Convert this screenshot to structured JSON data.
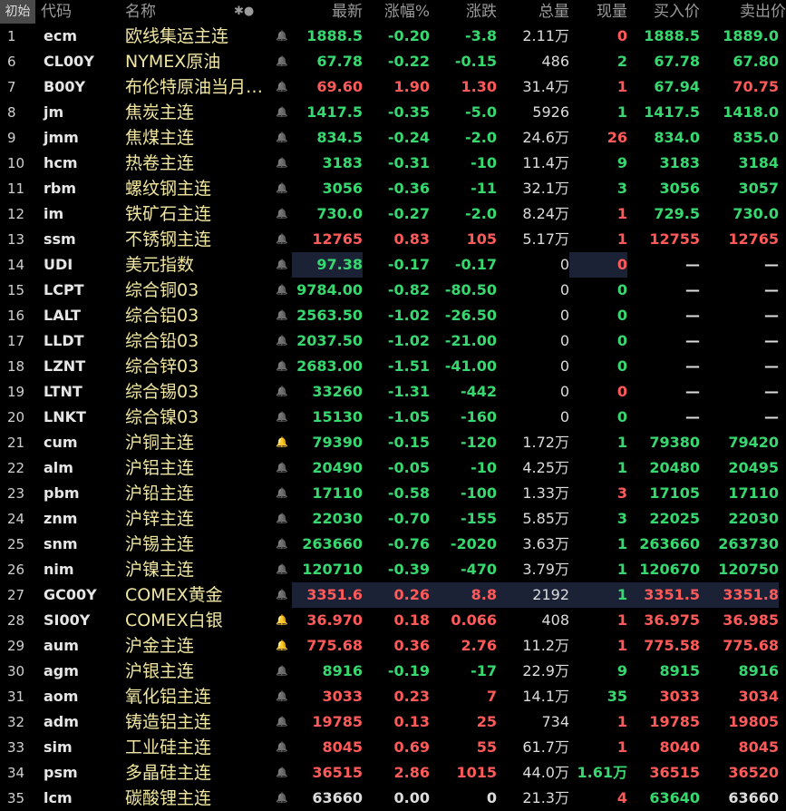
{
  "header": {
    "first": "初始",
    "code": "代码",
    "name": "名称",
    "icons": "✱●",
    "last": "最新",
    "pct": "涨幅%",
    "chg": "涨跌",
    "vol": "总量",
    "cur": "现量",
    "bid": "买入价",
    "ask": "卖出价"
  },
  "rows": [
    {
      "idx": "1",
      "code": "ecm",
      "name": "欧线集运主连",
      "bell": "off",
      "last": "1888.5",
      "pct": "-0.20",
      "chg": "-3.8",
      "vol": "2.11万",
      "cur": "0",
      "bid": "1888.5",
      "ask": "1889.0",
      "dir": "dn",
      "curdir": "up",
      "biddir": "dn",
      "askdir": "dn"
    },
    {
      "idx": "6",
      "code": "CL00Y",
      "name": "NYMEX原油",
      "bell": "off",
      "last": "67.78",
      "pct": "-0.22",
      "chg": "-0.15",
      "vol": "486",
      "cur": "2",
      "bid": "67.78",
      "ask": "67.80",
      "dir": "dn",
      "curdir": "dn",
      "biddir": "dn",
      "askdir": "dn"
    },
    {
      "idx": "7",
      "code": "B00Y",
      "name": "布伦特原油当月…",
      "bell": "off",
      "last": "69.60",
      "pct": "1.90",
      "chg": "1.30",
      "vol": "31.4万",
      "cur": "1",
      "bid": "67.94",
      "ask": "70.75",
      "dir": "up",
      "curdir": "up",
      "biddir": "dn",
      "askdir": "up"
    },
    {
      "idx": "8",
      "code": "jm",
      "name": "焦炭主连",
      "bell": "off",
      "last": "1417.5",
      "pct": "-0.35",
      "chg": "-5.0",
      "vol": "5926",
      "cur": "1",
      "bid": "1417.5",
      "ask": "1418.0",
      "dir": "dn",
      "curdir": "dn",
      "biddir": "dn",
      "askdir": "dn"
    },
    {
      "idx": "9",
      "code": "jmm",
      "name": "焦煤主连",
      "bell": "off",
      "last": "834.5",
      "pct": "-0.24",
      "chg": "-2.0",
      "vol": "24.6万",
      "cur": "26",
      "bid": "834.0",
      "ask": "835.0",
      "dir": "dn",
      "curdir": "up",
      "biddir": "dn",
      "askdir": "dn"
    },
    {
      "idx": "10",
      "code": "hcm",
      "name": "热卷主连",
      "bell": "off",
      "last": "3183",
      "pct": "-0.31",
      "chg": "-10",
      "vol": "11.4万",
      "cur": "9",
      "bid": "3183",
      "ask": "3184",
      "dir": "dn",
      "curdir": "dn",
      "biddir": "dn",
      "askdir": "dn"
    },
    {
      "idx": "11",
      "code": "rbm",
      "name": "螺纹钢主连",
      "bell": "off",
      "last": "3056",
      "pct": "-0.36",
      "chg": "-11",
      "vol": "32.1万",
      "cur": "3",
      "bid": "3056",
      "ask": "3057",
      "dir": "dn",
      "curdir": "dn",
      "biddir": "dn",
      "askdir": "dn"
    },
    {
      "idx": "12",
      "code": "im",
      "name": "铁矿石主连",
      "bell": "off",
      "last": "730.0",
      "pct": "-0.27",
      "chg": "-2.0",
      "vol": "8.24万",
      "cur": "1",
      "bid": "729.5",
      "ask": "730.0",
      "dir": "dn",
      "curdir": "up",
      "biddir": "dn",
      "askdir": "dn"
    },
    {
      "idx": "13",
      "code": "ssm",
      "name": "不锈钢主连",
      "bell": "off",
      "last": "12765",
      "pct": "0.83",
      "chg": "105",
      "vol": "5.17万",
      "cur": "1",
      "bid": "12755",
      "ask": "12765",
      "dir": "up",
      "curdir": "up",
      "biddir": "up",
      "askdir": "up"
    },
    {
      "idx": "14",
      "code": "UDI",
      "name": "美元指数",
      "bell": "off",
      "last": "97.38",
      "pct": "-0.17",
      "chg": "-0.17",
      "vol": "0",
      "cur": "0",
      "bid": "—",
      "ask": "—",
      "dir": "dn",
      "curdir": "up",
      "biddir": "fl",
      "askdir": "fl",
      "hl_last": true,
      "hl_cur": true
    },
    {
      "idx": "15",
      "code": "LCPT",
      "name": "综合铜03",
      "bell": "off",
      "last": "9784.00",
      "pct": "-0.82",
      "chg": "-80.50",
      "vol": "0",
      "cur": "0",
      "bid": "—",
      "ask": "—",
      "dir": "dn",
      "curdir": "dn",
      "biddir": "fl",
      "askdir": "fl"
    },
    {
      "idx": "16",
      "code": "LALT",
      "name": "综合铝03",
      "bell": "off",
      "last": "2563.50",
      "pct": "-1.02",
      "chg": "-26.50",
      "vol": "0",
      "cur": "0",
      "bid": "—",
      "ask": "—",
      "dir": "dn",
      "curdir": "dn",
      "biddir": "fl",
      "askdir": "fl"
    },
    {
      "idx": "17",
      "code": "LLDT",
      "name": "综合铅03",
      "bell": "off",
      "last": "2037.50",
      "pct": "-1.02",
      "chg": "-21.00",
      "vol": "0",
      "cur": "0",
      "bid": "—",
      "ask": "—",
      "dir": "dn",
      "curdir": "dn",
      "biddir": "fl",
      "askdir": "fl"
    },
    {
      "idx": "18",
      "code": "LZNT",
      "name": "综合锌03",
      "bell": "off",
      "last": "2683.00",
      "pct": "-1.51",
      "chg": "-41.00",
      "vol": "0",
      "cur": "0",
      "bid": "—",
      "ask": "—",
      "dir": "dn",
      "curdir": "dn",
      "biddir": "fl",
      "askdir": "fl"
    },
    {
      "idx": "19",
      "code": "LTNT",
      "name": "综合锡03",
      "bell": "off",
      "last": "33260",
      "pct": "-1.31",
      "chg": "-442",
      "vol": "0",
      "cur": "0",
      "bid": "—",
      "ask": "—",
      "dir": "dn",
      "curdir": "up",
      "biddir": "fl",
      "askdir": "fl"
    },
    {
      "idx": "20",
      "code": "LNKT",
      "name": "综合镍03",
      "bell": "off",
      "last": "15130",
      "pct": "-1.05",
      "chg": "-160",
      "vol": "0",
      "cur": "0",
      "bid": "—",
      "ask": "—",
      "dir": "dn",
      "curdir": "dn",
      "biddir": "fl",
      "askdir": "fl"
    },
    {
      "idx": "21",
      "code": "cum",
      "name": "沪铜主连",
      "bell": "on",
      "last": "79390",
      "pct": "-0.15",
      "chg": "-120",
      "vol": "1.72万",
      "cur": "1",
      "bid": "79380",
      "ask": "79420",
      "dir": "dn",
      "curdir": "dn",
      "biddir": "dn",
      "askdir": "dn"
    },
    {
      "idx": "22",
      "code": "alm",
      "name": "沪铝主连",
      "bell": "off",
      "last": "20490",
      "pct": "-0.05",
      "chg": "-10",
      "vol": "4.25万",
      "cur": "1",
      "bid": "20480",
      "ask": "20495",
      "dir": "dn",
      "curdir": "dn",
      "biddir": "dn",
      "askdir": "dn"
    },
    {
      "idx": "23",
      "code": "pbm",
      "name": "沪铅主连",
      "bell": "off",
      "last": "17110",
      "pct": "-0.58",
      "chg": "-100",
      "vol": "1.33万",
      "cur": "3",
      "bid": "17105",
      "ask": "17110",
      "dir": "dn",
      "curdir": "up",
      "biddir": "dn",
      "askdir": "dn"
    },
    {
      "idx": "24",
      "code": "znm",
      "name": "沪锌主连",
      "bell": "off",
      "last": "22030",
      "pct": "-0.70",
      "chg": "-155",
      "vol": "5.85万",
      "cur": "3",
      "bid": "22025",
      "ask": "22030",
      "dir": "dn",
      "curdir": "dn",
      "biddir": "dn",
      "askdir": "dn"
    },
    {
      "idx": "25",
      "code": "snm",
      "name": "沪锡主连",
      "bell": "off",
      "last": "263660",
      "pct": "-0.76",
      "chg": "-2020",
      "vol": "3.63万",
      "cur": "1",
      "bid": "263660",
      "ask": "263730",
      "dir": "dn",
      "curdir": "dn",
      "biddir": "dn",
      "askdir": "dn"
    },
    {
      "idx": "26",
      "code": "nim",
      "name": "沪镍主连",
      "bell": "off",
      "last": "120710",
      "pct": "-0.39",
      "chg": "-470",
      "vol": "3.79万",
      "cur": "1",
      "bid": "120670",
      "ask": "120750",
      "dir": "dn",
      "curdir": "dn",
      "biddir": "dn",
      "askdir": "dn"
    },
    {
      "idx": "27",
      "code": "GC00Y",
      "name": "COMEX黄金",
      "bell": "off",
      "last": "3351.6",
      "pct": "0.26",
      "chg": "8.8",
      "vol": "2192",
      "cur": "1",
      "bid": "3351.5",
      "ask": "3351.8",
      "dir": "up",
      "curdir": "dn",
      "biddir": "up",
      "askdir": "up",
      "hl_row": true
    },
    {
      "idx": "28",
      "code": "SI00Y",
      "name": "COMEX白银",
      "bell": "on",
      "last": "36.970",
      "pct": "0.18",
      "chg": "0.066",
      "vol": "408",
      "cur": "1",
      "bid": "36.975",
      "ask": "36.985",
      "dir": "up",
      "curdir": "up",
      "biddir": "up",
      "askdir": "up"
    },
    {
      "idx": "29",
      "code": "aum",
      "name": "沪金主连",
      "bell": "on",
      "last": "775.68",
      "pct": "0.36",
      "chg": "2.76",
      "vol": "11.2万",
      "cur": "1",
      "bid": "775.58",
      "ask": "775.68",
      "dir": "up",
      "curdir": "up",
      "biddir": "up",
      "askdir": "up"
    },
    {
      "idx": "30",
      "code": "agm",
      "name": "沪银主连",
      "bell": "off",
      "last": "8916",
      "pct": "-0.19",
      "chg": "-17",
      "vol": "22.9万",
      "cur": "9",
      "bid": "8915",
      "ask": "8916",
      "dir": "dn",
      "curdir": "dn",
      "biddir": "dn",
      "askdir": "dn"
    },
    {
      "idx": "31",
      "code": "aom",
      "name": "氧化铝主连",
      "bell": "off",
      "last": "3033",
      "pct": "0.23",
      "chg": "7",
      "vol": "14.1万",
      "cur": "35",
      "bid": "3033",
      "ask": "3034",
      "dir": "up",
      "curdir": "dn",
      "biddir": "up",
      "askdir": "up"
    },
    {
      "idx": "32",
      "code": "adm",
      "name": "铸造铝主连",
      "bell": "off",
      "last": "19785",
      "pct": "0.13",
      "chg": "25",
      "vol": "734",
      "cur": "1",
      "bid": "19785",
      "ask": "19805",
      "dir": "up",
      "curdir": "up",
      "biddir": "up",
      "askdir": "up"
    },
    {
      "idx": "33",
      "code": "sim",
      "name": "工业硅主连",
      "bell": "off",
      "last": "8045",
      "pct": "0.69",
      "chg": "55",
      "vol": "61.7万",
      "cur": "1",
      "bid": "8040",
      "ask": "8045",
      "dir": "up",
      "curdir": "up",
      "biddir": "up",
      "askdir": "up"
    },
    {
      "idx": "34",
      "code": "psm",
      "name": "多晶硅主连",
      "bell": "off",
      "last": "36515",
      "pct": "2.86",
      "chg": "1015",
      "vol": "44.0万",
      "cur": "1.61万",
      "bid": "36515",
      "ask": "36520",
      "dir": "up",
      "curdir": "dn",
      "biddir": "up",
      "askdir": "up"
    },
    {
      "idx": "35",
      "code": "lcm",
      "name": "碳酸锂主连",
      "bell": "off",
      "last": "63660",
      "pct": "0.00",
      "chg": "0",
      "vol": "21.3万",
      "cur": "4",
      "bid": "63640",
      "ask": "63660",
      "dir": "fl",
      "curdir": "up",
      "biddir": "dn",
      "askdir": "fl"
    }
  ]
}
